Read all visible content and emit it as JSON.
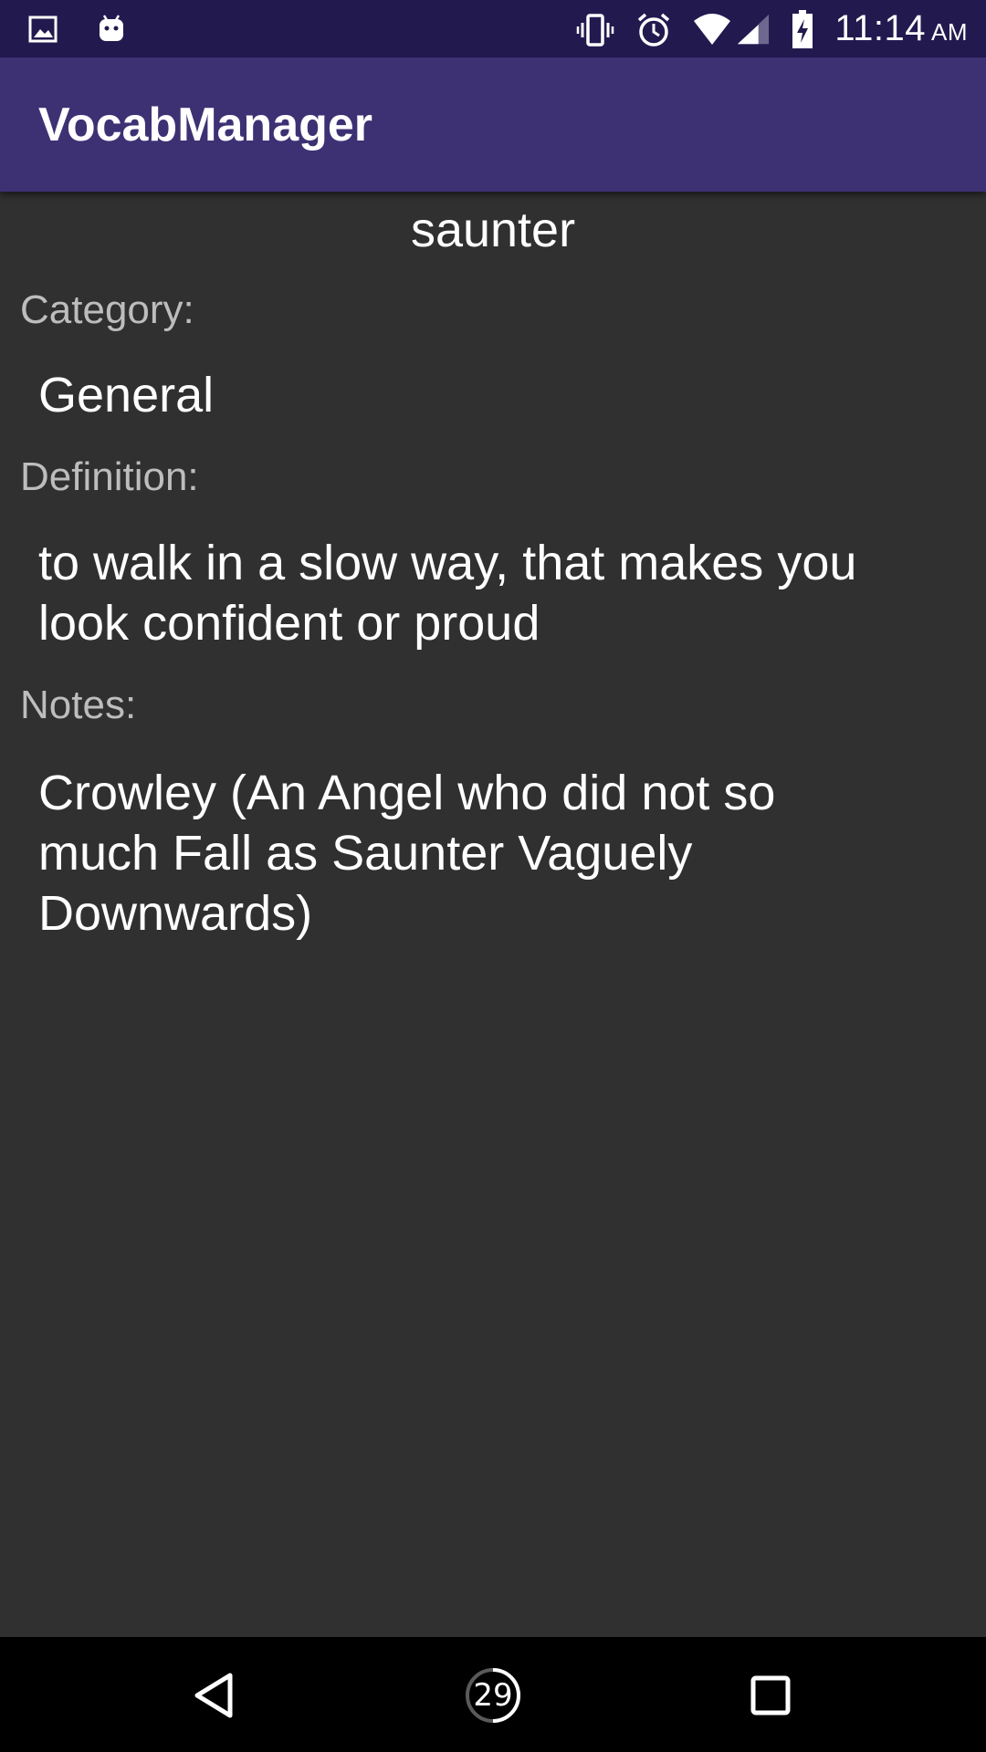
{
  "status_bar": {
    "time": "11:14",
    "ampm": "AM",
    "icons_left": [
      "image-icon",
      "android-icon"
    ],
    "icons_right": [
      "vibrate-icon",
      "alarm-icon",
      "wifi-icon",
      "signal-icon",
      "battery-charging-icon"
    ]
  },
  "app_bar": {
    "title": "VocabManager"
  },
  "entry": {
    "word": "saunter",
    "category_label": "Category:",
    "category_value": "General",
    "definition_label": "Definition:",
    "definition_value": "to walk in a slow way, that makes you look confident or proud",
    "notes_label": "Notes:",
    "notes_value": "Crowley (An Angel who did not so much Fall as Saunter Vaguely Downwards)"
  },
  "nav_bar": {
    "home_badge": "29",
    "icons": [
      "back-icon",
      "home-icon",
      "recents-icon"
    ]
  },
  "colors": {
    "status_bar": "#221a4f",
    "app_bar": "#3d3174",
    "background": "#303030",
    "label": "#bdbdbd",
    "text": "#ffffff"
  }
}
